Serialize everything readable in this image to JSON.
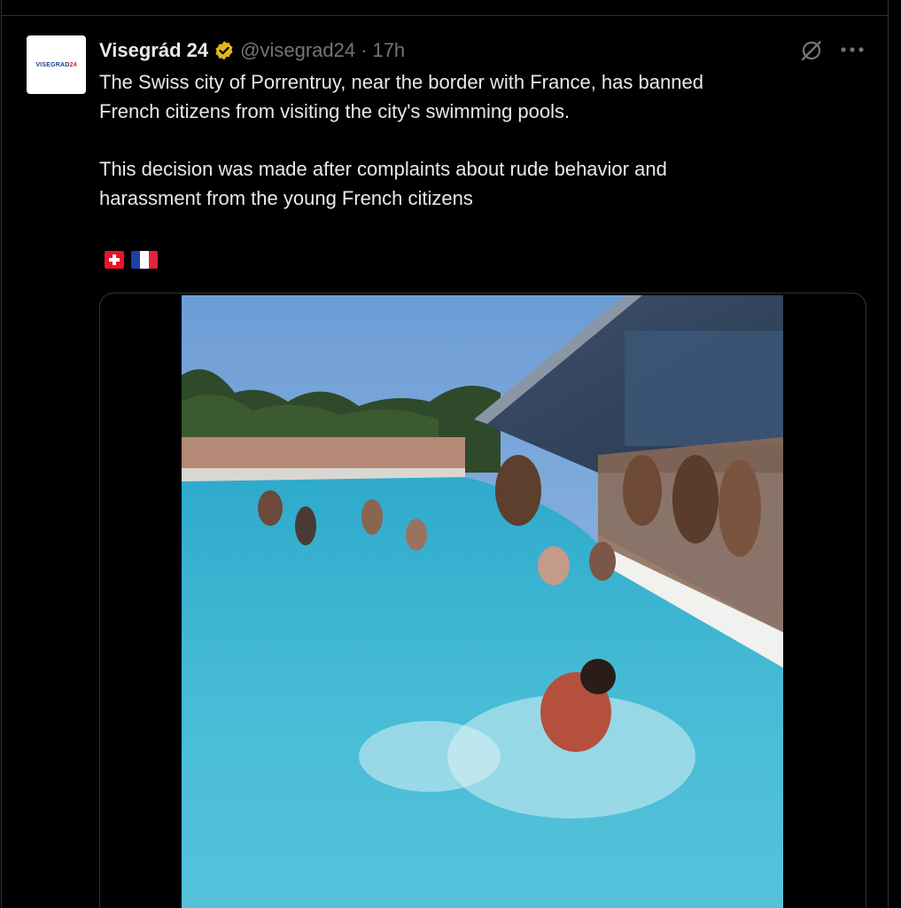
{
  "tweet": {
    "avatar_text_part1": "VISEGRAD",
    "avatar_text_part2": "24",
    "display_name": "Visegrád 24",
    "verified_badge": "verified-gold-badge-icon",
    "handle": "@visegrad24",
    "separator": "·",
    "time": "17h",
    "paragraph1": "The Swiss city of Porrentruy, near the border with France, has banned\nFrench citizens from visiting the city's swimming pools.",
    "paragraph2": "This decision was made after complaints about rude behavior and\nharassment from the young French citizens",
    "flags": [
      "swiss-flag-icon",
      "french-flag-icon"
    ],
    "header_actions": [
      "grok-icon",
      "more-icon"
    ]
  },
  "colors": {
    "background": "#000000",
    "border": "#2f3336",
    "primary_text": "#e7e9ea",
    "secondary_text": "#71767b",
    "verified_gold": "#e2b719",
    "pool_water": "#3fb6cf",
    "sky": "#7fa9d8"
  }
}
